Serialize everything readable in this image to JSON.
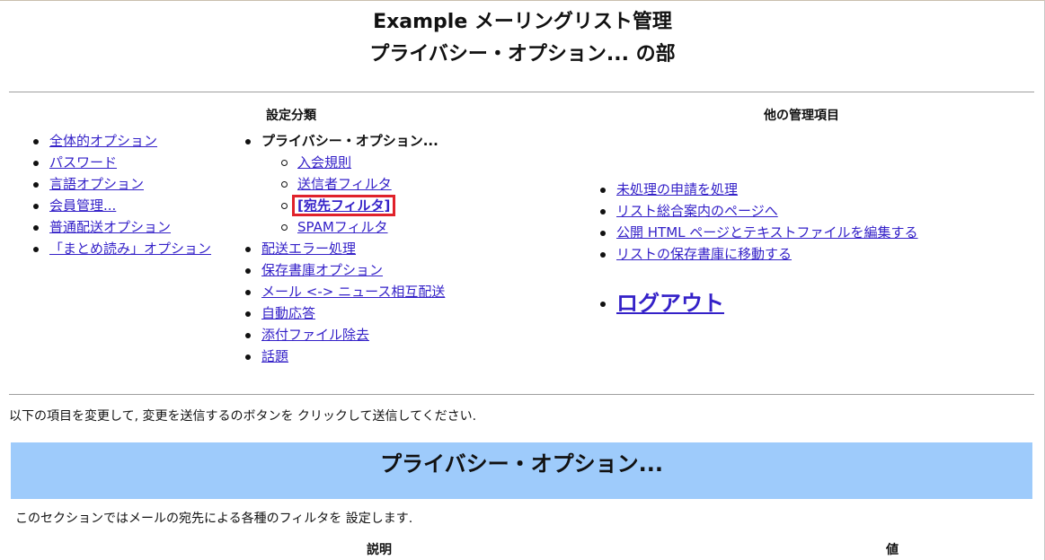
{
  "page": {
    "title_line1": "Example メーリングリスト管理",
    "title_line2": "プライバシー・オプション... の部"
  },
  "settings": {
    "heading": "設定分類",
    "left_items": [
      {
        "label": "全体的オプション"
      },
      {
        "label": "パスワード"
      },
      {
        "label": "言語オプション"
      },
      {
        "label": "会員管理..."
      },
      {
        "label": "普通配送オプション"
      },
      {
        "label": "「まとめ読み」オプション"
      }
    ],
    "current_category": "プライバシー・オプション...",
    "sub_items": [
      {
        "label": "入会規則"
      },
      {
        "label": "送信者フィルタ"
      },
      {
        "label": "[宛先フィルタ]",
        "active": true
      },
      {
        "label": "SPAMフィルタ"
      }
    ],
    "right_items": [
      {
        "label": "配送エラー処理"
      },
      {
        "label": "保存書庫オプション"
      },
      {
        "label": "メール <-> ニュース相互配送"
      },
      {
        "label": "自動応答"
      },
      {
        "label": "添付ファイル除去"
      },
      {
        "label": "話題"
      }
    ]
  },
  "other_admin": {
    "heading": "他の管理項目",
    "items": [
      {
        "label": "未処理の申請を処理"
      },
      {
        "label": "リスト総合案内のページへ"
      },
      {
        "label": "公開 HTML ページとテキストファイルを編集する"
      },
      {
        "label": "リストの保存書庫に移動する"
      }
    ],
    "logout": "ログアウト"
  },
  "instructions": "以下の項目を変更して, 変更を送信するのボタンを クリックして送信してください.",
  "section": {
    "title": "プライバシー・オプション...",
    "description": "このセクションではメールの宛先による各種のフィルタを 設定します."
  },
  "table": {
    "col_description": "説明",
    "col_value": "値"
  },
  "colors": {
    "link": "#3421c8",
    "section_bg": "#9ecbfb",
    "highlight_border": "#e0222b"
  }
}
